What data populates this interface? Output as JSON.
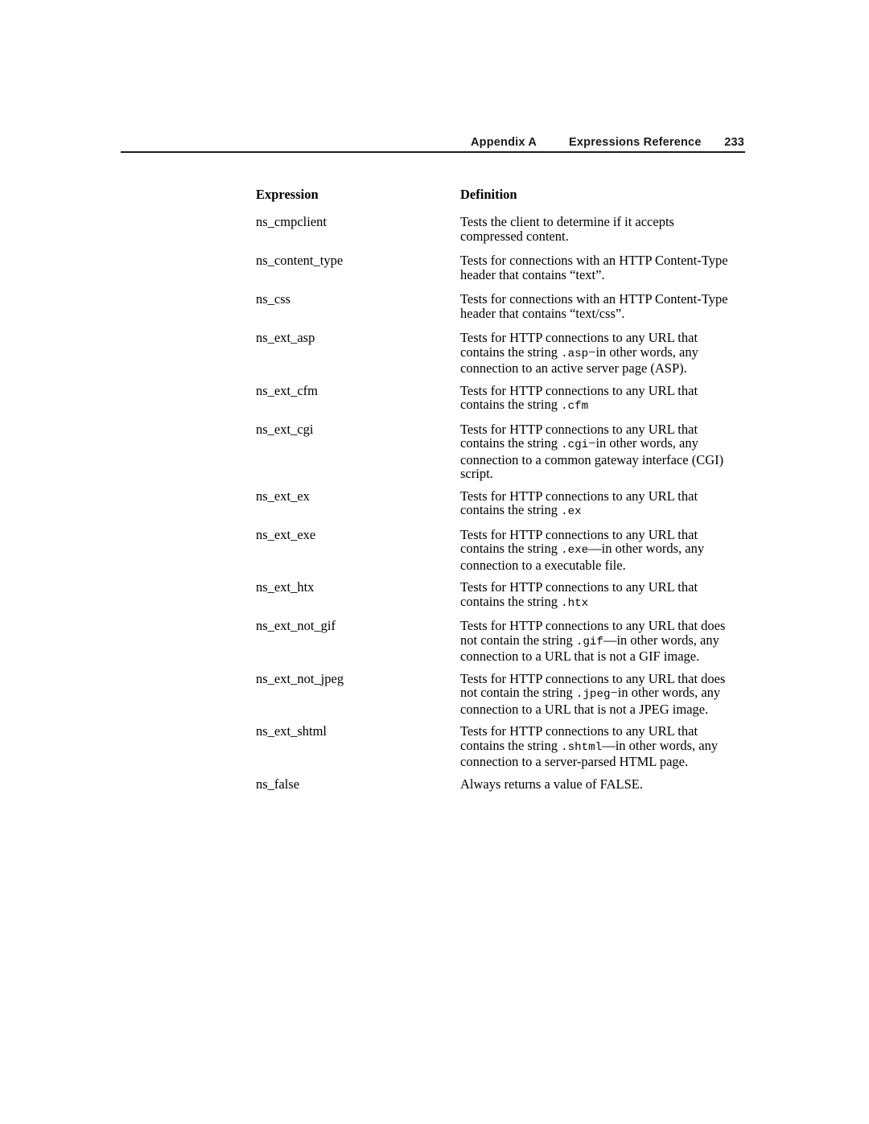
{
  "page": {
    "running_header": {
      "appendix": "Appendix  A",
      "chapter_title": "Expressions Reference",
      "page_number": "233"
    }
  },
  "table": {
    "headers": {
      "expression": "Expression",
      "definition": "Definition"
    },
    "rows": [
      {
        "expression": "ns_cmpclient",
        "lines": [
          [
            {
              "t": "Tests the client to determine if it accepts",
              "mono": false
            }
          ],
          [
            {
              "t": "compressed content.",
              "mono": false
            }
          ]
        ]
      },
      {
        "expression": "ns_content_type",
        "lines": [
          [
            {
              "t": "Tests for connections with an HTTP Content-Type",
              "mono": false
            }
          ],
          [
            {
              "t": "header that contains “text”.",
              "mono": false
            }
          ]
        ]
      },
      {
        "expression": "ns_css",
        "lines": [
          [
            {
              "t": "Tests for connections with an HTTP Content-Type",
              "mono": false
            }
          ],
          [
            {
              "t": "header that contains “text/css”.",
              "mono": false
            }
          ]
        ]
      },
      {
        "expression": "ns_ext_asp",
        "lines": [
          [
            {
              "t": "Tests for HTTP connections to any URL that",
              "mono": false
            }
          ],
          [
            {
              "t": "contains the string ",
              "mono": false
            },
            {
              "t": ".asp",
              "mono": true
            },
            {
              "t": "−in other words, any",
              "mono": false
            }
          ],
          [
            {
              "t": "connection to an active server page (ASP).",
              "mono": false
            }
          ]
        ]
      },
      {
        "expression": "ns_ext_cfm",
        "lines": [
          [
            {
              "t": "Tests for HTTP connections to any URL that",
              "mono": false
            }
          ],
          [
            {
              "t": "contains the string ",
              "mono": false
            },
            {
              "t": ".cfm",
              "mono": true
            }
          ]
        ]
      },
      {
        "expression": "ns_ext_cgi",
        "lines": [
          [
            {
              "t": "Tests for HTTP connections to any URL that",
              "mono": false
            }
          ],
          [
            {
              "t": "contains the string ",
              "mono": false
            },
            {
              "t": ".cgi",
              "mono": true
            },
            {
              "t": "−in other words, any",
              "mono": false
            }
          ],
          [
            {
              "t": "connection to a common gateway interface (CGI)",
              "mono": false
            }
          ],
          [
            {
              "t": "script.",
              "mono": false
            }
          ]
        ]
      },
      {
        "expression": "ns_ext_ex",
        "lines": [
          [
            {
              "t": "Tests for HTTP connections to any URL that",
              "mono": false
            }
          ],
          [
            {
              "t": "contains the string ",
              "mono": false
            },
            {
              "t": ".ex",
              "mono": true
            }
          ]
        ]
      },
      {
        "expression": "ns_ext_exe",
        "lines": [
          [
            {
              "t": "Tests for HTTP connections to any URL that",
              "mono": false
            }
          ],
          [
            {
              "t": "contains the string ",
              "mono": false
            },
            {
              "t": ".exe",
              "mono": true
            },
            {
              "t": "—in other words, any",
              "mono": false
            }
          ],
          [
            {
              "t": "connection to a executable file.",
              "mono": false
            }
          ]
        ]
      },
      {
        "expression": "ns_ext_htx",
        "lines": [
          [
            {
              "t": "Tests for HTTP connections to any URL that",
              "mono": false
            }
          ],
          [
            {
              "t": "contains the string ",
              "mono": false
            },
            {
              "t": ".htx",
              "mono": true
            }
          ]
        ]
      },
      {
        "expression": "ns_ext_not_gif",
        "lines": [
          [
            {
              "t": "Tests for HTTP connections to any URL that does",
              "mono": false
            }
          ],
          [
            {
              "t": "not contain the string ",
              "mono": false
            },
            {
              "t": ".gif",
              "mono": true
            },
            {
              "t": "—in other words, any",
              "mono": false
            }
          ],
          [
            {
              "t": "connection to a URL that is not a GIF image.",
              "mono": false
            }
          ]
        ]
      },
      {
        "expression": "ns_ext_not_jpeg",
        "lines": [
          [
            {
              "t": "Tests for HTTP connections to any URL that does",
              "mono": false
            }
          ],
          [
            {
              "t": "not contain the string ",
              "mono": false
            },
            {
              "t": ".jpeg",
              "mono": true
            },
            {
              "t": "−in other words, any",
              "mono": false
            }
          ],
          [
            {
              "t": "connection to a URL that is not a JPEG image.",
              "mono": false
            }
          ]
        ]
      },
      {
        "expression": "ns_ext_shtml",
        "lines": [
          [
            {
              "t": "Tests for HTTP connections to any URL that",
              "mono": false
            }
          ],
          [
            {
              "t": "contains the string ",
              "mono": false
            },
            {
              "t": ".shtml",
              "mono": true
            },
            {
              "t": "—in other words, any",
              "mono": false
            }
          ],
          [
            {
              "t": "connection to a server-parsed HTML page.",
              "mono": false
            }
          ]
        ]
      },
      {
        "expression": "ns_false",
        "lines": [
          [
            {
              "t": "Always returns a value of FALSE.",
              "mono": false
            }
          ]
        ]
      }
    ]
  }
}
